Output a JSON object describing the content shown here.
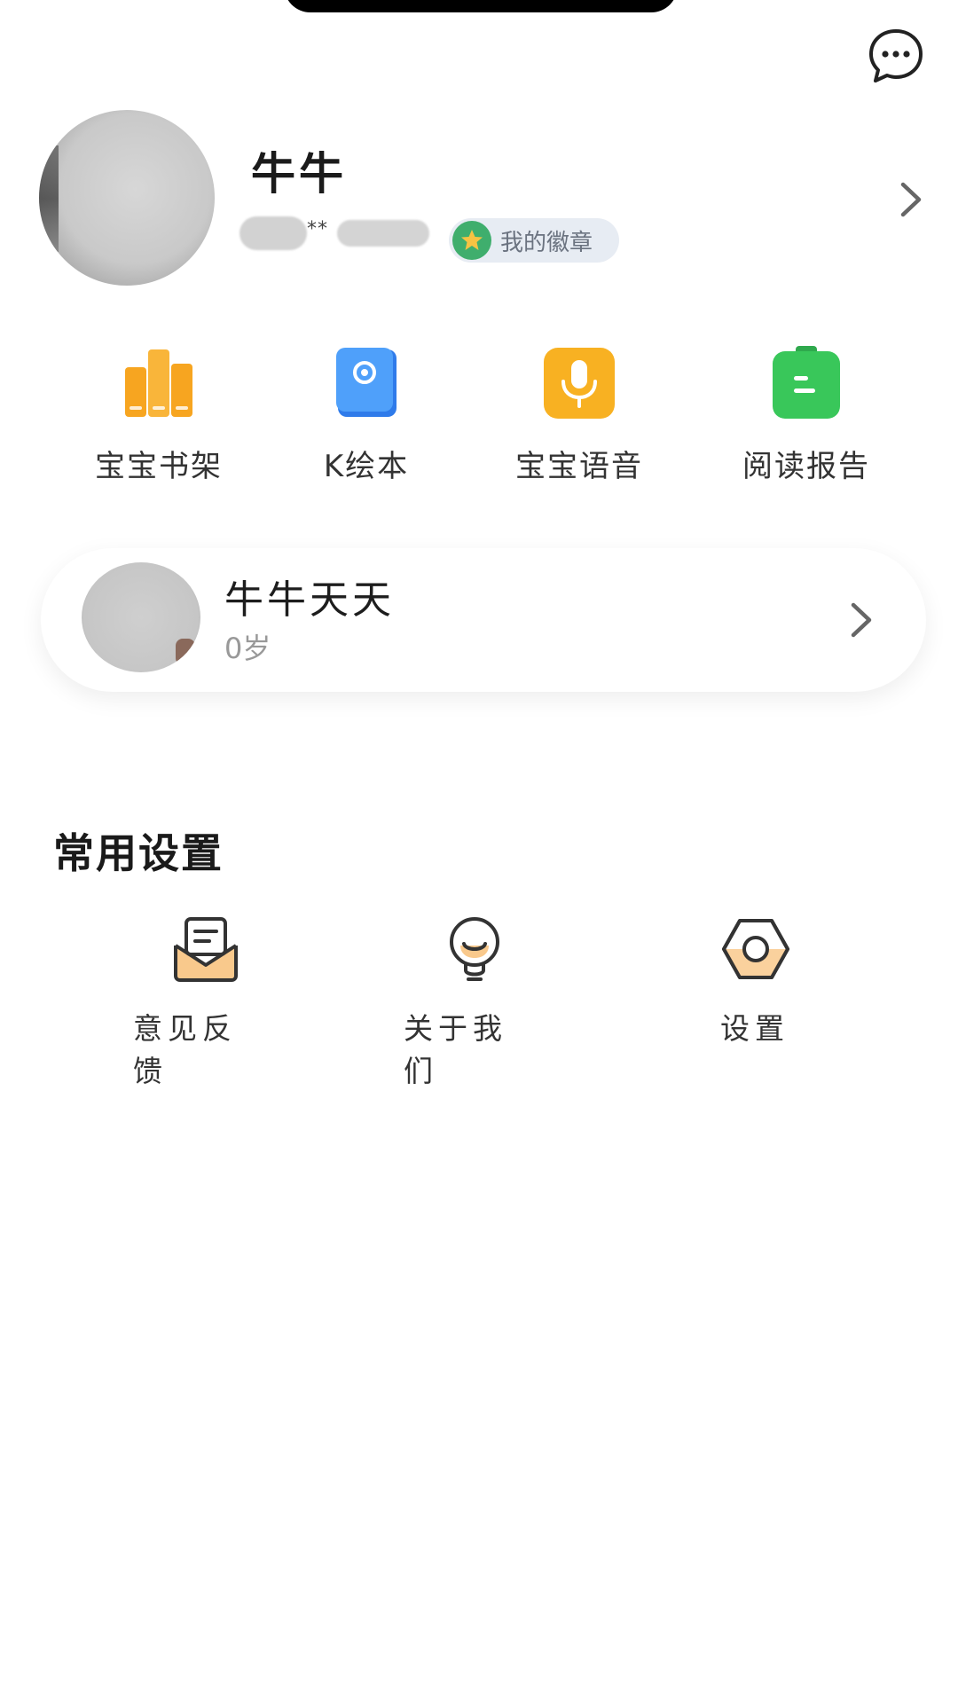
{
  "header": {
    "message_icon": "chat-bubble-icon"
  },
  "profile": {
    "name": "牛牛",
    "masked_id": "**",
    "badge_label": "我的徽章",
    "badge_icon": "star-icon",
    "chevron_icon": "chevron-right-icon"
  },
  "quick_actions": [
    {
      "label": "宝宝书架",
      "icon": "bookshelf-icon",
      "color": "#F7A520"
    },
    {
      "label": "K绘本",
      "icon": "picture-book-icon",
      "color": "#3C8CF5"
    },
    {
      "label": "宝宝语音",
      "icon": "microphone-icon",
      "color": "#F8B122"
    },
    {
      "label": "阅读报告",
      "icon": "report-icon",
      "color": "#39C75A"
    }
  ],
  "child": {
    "name": "牛牛天天",
    "age": "0岁",
    "chevron_icon": "chevron-right-icon"
  },
  "settings": {
    "title": "常用设置",
    "items": [
      {
        "label": "意见反馈",
        "icon": "feedback-icon"
      },
      {
        "label": "关于我们",
        "icon": "lightbulb-icon"
      },
      {
        "label": "设置",
        "icon": "settings-icon"
      }
    ]
  },
  "colors": {
    "accent_orange": "#F9C98C",
    "badge_green": "#3FAE6D",
    "badge_bg": "#E7ECF3"
  }
}
